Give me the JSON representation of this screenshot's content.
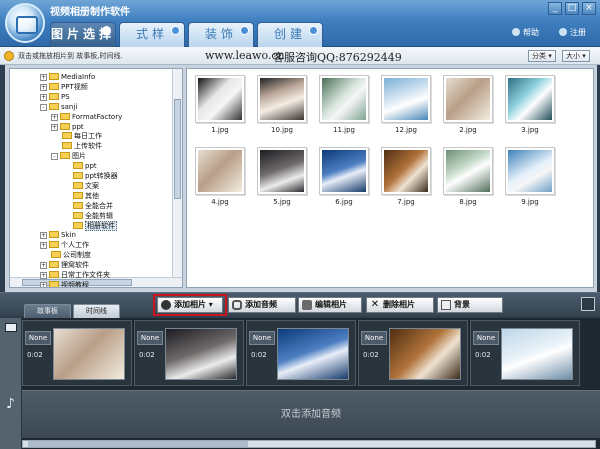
{
  "app": {
    "title": "视频相册制作软件",
    "window_buttons": [
      "_",
      "□",
      "×"
    ]
  },
  "tabs": [
    {
      "label": "图片选择",
      "active": true
    },
    {
      "label": "式样",
      "active": false
    },
    {
      "label": "装饰",
      "active": false
    },
    {
      "label": "创建",
      "active": false
    }
  ],
  "header_links": {
    "help": "帮助",
    "register": "注册"
  },
  "infobar": {
    "hint": "双击或拖放相片到 故事板,时间线.",
    "website": "www.leawo.cn",
    "qq": "客服咨询QQ:876292449",
    "sort_label": "分类",
    "size_label": "大小"
  },
  "tree": [
    {
      "label": "MediaInfo",
      "depth": 0,
      "expand": "+"
    },
    {
      "label": "PPT视频",
      "depth": 0,
      "expand": "+"
    },
    {
      "label": "PS",
      "depth": 0,
      "expand": "+"
    },
    {
      "label": "sanji",
      "depth": 0,
      "expand": "-"
    },
    {
      "label": "FormatFactory",
      "depth": 1,
      "expand": "+"
    },
    {
      "label": "ppt",
      "depth": 1,
      "expand": "+"
    },
    {
      "label": "每日工作",
      "depth": 1,
      "expand": ""
    },
    {
      "label": "上传软件",
      "depth": 1,
      "expand": ""
    },
    {
      "label": "图片",
      "depth": 1,
      "expand": "-"
    },
    {
      "label": "ppt",
      "depth": 2,
      "expand": ""
    },
    {
      "label": "ppt转换器",
      "depth": 2,
      "expand": ""
    },
    {
      "label": "文案",
      "depth": 2,
      "expand": ""
    },
    {
      "label": "其他",
      "depth": 2,
      "expand": ""
    },
    {
      "label": "全能合并",
      "depth": 2,
      "expand": ""
    },
    {
      "label": "全能剪辑",
      "depth": 2,
      "expand": ""
    },
    {
      "label": "相册软件",
      "depth": 2,
      "expand": "",
      "selected": true
    },
    {
      "label": "Skin",
      "depth": 0,
      "expand": "+"
    },
    {
      "label": "个人工作",
      "depth": 0,
      "expand": "+"
    },
    {
      "label": "公司制度",
      "depth": 0,
      "expand": ""
    },
    {
      "label": "狸窝软件",
      "depth": 0,
      "expand": "+"
    },
    {
      "label": "日常工作文件夹",
      "depth": 0,
      "expand": "+"
    },
    {
      "label": "视频教程",
      "depth": 0,
      "expand": "+"
    }
  ],
  "photos": [
    {
      "name": "1.jpg",
      "tone": "photo-h"
    },
    {
      "name": "10.jpg",
      "tone": "photo-f"
    },
    {
      "name": "11.jpg",
      "tone": "photo-c"
    },
    {
      "name": "12.jpg",
      "tone": "photo-d"
    },
    {
      "name": "2.jpg",
      "tone": "photo-a"
    },
    {
      "name": "3.jpg",
      "tone": "photo-e"
    },
    {
      "name": "4.jpg",
      "tone": "photo-a"
    },
    {
      "name": "5.jpg",
      "tone": "photo-b"
    },
    {
      "name": "6.jpg",
      "tone": "photo-i"
    },
    {
      "name": "7.jpg",
      "tone": "photo-j"
    },
    {
      "name": "8.jpg",
      "tone": "photo-k"
    },
    {
      "name": "9.jpg",
      "tone": "photo-g"
    }
  ],
  "toolbar": {
    "add_photo": "添加相片",
    "add_audio": "添加音频",
    "edit_photo": "编辑相片",
    "delete_photo": "删除相片",
    "background": "背景"
  },
  "timeline_tabs": [
    {
      "label": "故事板",
      "active": true
    },
    {
      "label": "时间线",
      "active": false
    }
  ],
  "storyboard": {
    "frames": [
      {
        "transition": "None",
        "duration": "0:02",
        "tone": "photo-a"
      },
      {
        "transition": "None",
        "duration": "0:02",
        "tone": "photo-b"
      },
      {
        "transition": "None",
        "duration": "0:02",
        "tone": "photo-i"
      },
      {
        "transition": "None",
        "duration": "0:02",
        "tone": "photo-j"
      },
      {
        "transition": "None",
        "duration": "0:02",
        "tone": "photo-l"
      }
    ],
    "audio_hint": "双击添加音频"
  },
  "colors": {
    "header_blue": "#3f7fc0",
    "highlight_red": "#c8141c",
    "folder_yellow": "#f6cf55"
  }
}
